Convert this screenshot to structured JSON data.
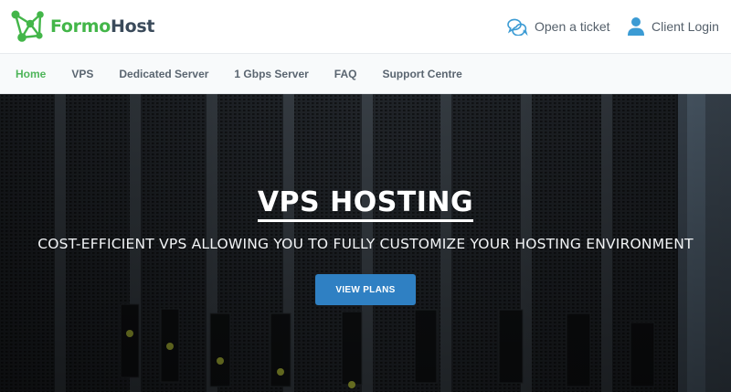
{
  "brand": {
    "name_part1": "Formo",
    "name_part2": "Host",
    "logo_icon": "network-nodes-icon",
    "colors": {
      "green": "#43b649",
      "dark": "#3a4a5a"
    }
  },
  "header": {
    "ticket": {
      "label": "Open a ticket",
      "icon": "chat-bubbles-icon"
    },
    "login": {
      "label": "Client Login",
      "icon": "user-icon"
    }
  },
  "nav": {
    "items": [
      {
        "label": "Home",
        "active": true
      },
      {
        "label": "VPS",
        "active": false
      },
      {
        "label": "Dedicated Server",
        "active": false
      },
      {
        "label": "1 Gbps Server",
        "active": false
      },
      {
        "label": "FAQ",
        "active": false
      },
      {
        "label": "Support Centre",
        "active": false
      }
    ],
    "active_color": "#4fb55a"
  },
  "hero": {
    "title": "VPS HOSTING",
    "subtitle": "COST-EFFICIENT VPS ALLOWING YOU TO FULLY CUSTOMIZE YOUR HOSTING ENVIRONMENT",
    "button_label": "VIEW PLANS",
    "button_color": "#2f80c3",
    "background": "server-rack-photo"
  }
}
